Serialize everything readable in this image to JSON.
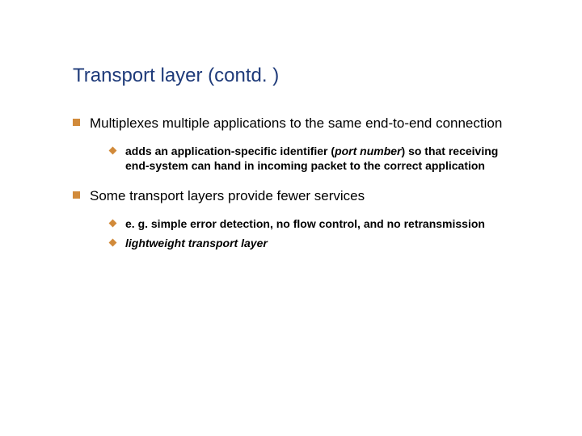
{
  "title": "Transport layer (contd. )",
  "bullets": [
    {
      "text": "Multiplexes multiple applications to the same end-to-end connection",
      "sub": [
        {
          "prefix": "adds an application-specific identifier (",
          "italic": "port number",
          "suffix": ") so that receiving end-system can hand in incoming packet to the correct application"
        }
      ]
    },
    {
      "text": "Some transport layers provide fewer services",
      "sub": [
        {
          "plain": "e. g. simple error detection, no flow control, and no retransmission"
        },
        {
          "full_italic": "lightweight transport layer"
        }
      ]
    }
  ]
}
